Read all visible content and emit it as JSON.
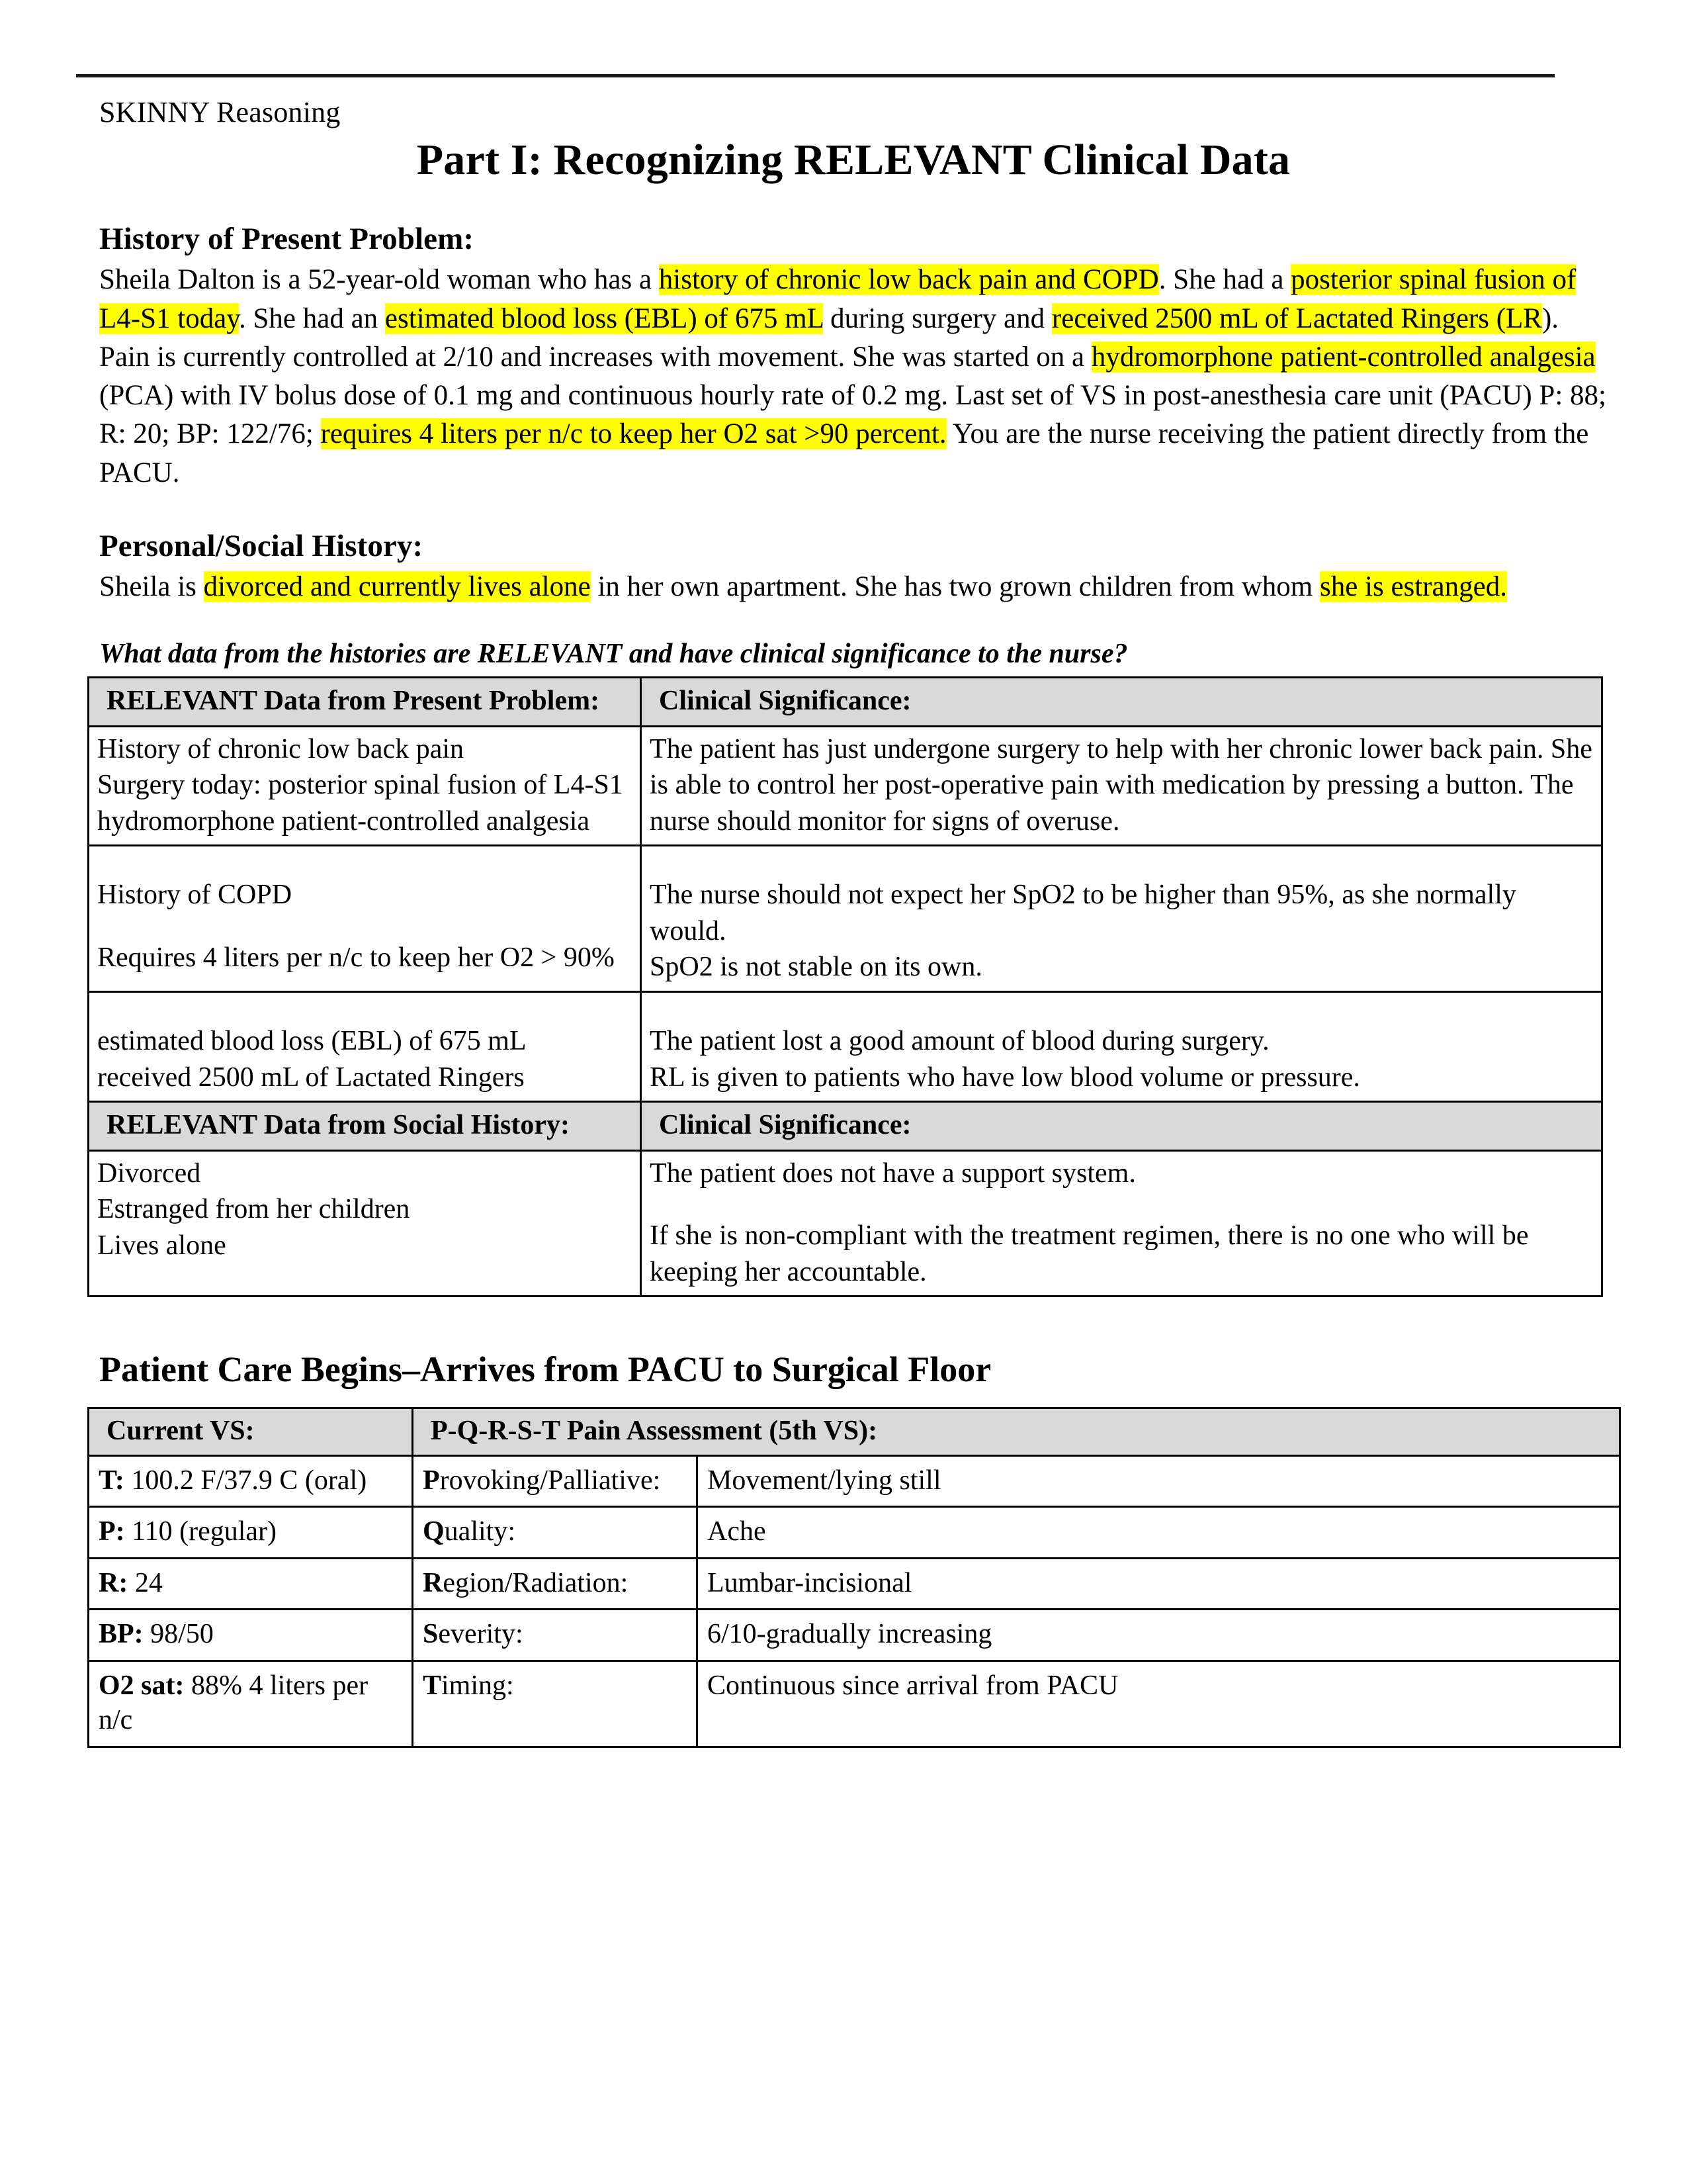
{
  "header": {
    "doc_label": "SKINNY Reasoning",
    "title": "Part I: Recognizing RELEVANT Clinical Data"
  },
  "present_problem": {
    "heading": "History of Present Problem:",
    "segments": [
      {
        "text": "Sheila Dalton is a 52-year-old woman who has a ",
        "highlight": false
      },
      {
        "text": "history of chronic low back pain and COPD",
        "highlight": true
      },
      {
        "text": ". She had a ",
        "highlight": false
      },
      {
        "text": "posterior spinal fusion of L4-S1 today",
        "highlight": true
      },
      {
        "text": ". She had an ",
        "highlight": false
      },
      {
        "text": "estimated blood loss (EBL) of 675 mL",
        "highlight": true
      },
      {
        "text": " during surgery and ",
        "highlight": false
      },
      {
        "text": "received 2500 mL of Lactated Ringers (LR",
        "highlight": true
      },
      {
        "text": "). Pain is currently controlled at 2/10 and increases with movement. She was started on a ",
        "highlight": false
      },
      {
        "text": "hydromorphone patient-controlled analgesia",
        "highlight": true
      },
      {
        "text": " (PCA) with IV bolus dose of 0.1 mg and continuous hourly rate of 0.2 mg. Last set of VS in post-anesthesia care unit (PACU) P: 88; R: 20; BP: 122/76; ",
        "highlight": false
      },
      {
        "text": "requires 4 liters per n/c to keep her O2 sat >90 percent.",
        "highlight": true
      },
      {
        "text": " You are the nurse receiving the patient directly from the PACU.",
        "highlight": false
      }
    ]
  },
  "social_history": {
    "heading": "Personal/Social History:",
    "segments": [
      {
        "text": "Sheila is ",
        "highlight": false
      },
      {
        "text": "divorced and currently lives alone",
        "highlight": true
      },
      {
        "text": " in her own apartment. She has two grown children from whom ",
        "highlight": false
      },
      {
        "text": "she is estranged.",
        "highlight": true
      }
    ]
  },
  "question": "What data from the histories are RELEVANT and have clinical significance to the nurse?",
  "relevant_table": {
    "header_present": {
      "col1": "RELEVANT Data from Present Problem:",
      "col2": "Clinical Significance:"
    },
    "present_rows": {
      "data": [
        "History of chronic low back pain",
        "Surgery today: posterior spinal fusion of L4-S1",
        "hydromorphone patient-controlled analgesia"
      ],
      "significance": "The patient has just undergone surgery to help with her chronic lower back pain. She is able to control her post-operative pain with medication by pressing a button. The nurse should monitor for signs of overuse."
    },
    "copd_row": {
      "data": "History of COPD",
      "significance_1": "The nurse should not expect her SpO2 to be higher than 95%, as she normally would.",
      "data_2": "Requires 4 liters per n/c to keep her O2 > 90%",
      "significance_2": "SpO2 is not stable on its own."
    },
    "blood_row": {
      "data_1": "estimated blood loss (EBL) of 675 mL",
      "significance_1": "The patient lost a good amount of blood during surgery.",
      "data_2": "received 2500 mL of Lactated Ringers",
      "significance_2": "RL is given to patients who have low blood volume or pressure."
    },
    "header_social": {
      "col1": "RELEVANT Data from Social History:",
      "col2": "Clinical Significance:"
    },
    "social_rows": {
      "data": [
        "Divorced",
        "Estranged from her children",
        "Lives alone"
      ],
      "significance_1": "The patient does not have a support system.",
      "significance_2": "If she is non-compliant with the treatment regimen, there is no one who will be keeping her accountable."
    }
  },
  "care_section": {
    "heading": "Patient Care Begins–Arrives from PACU to Surgical Floor",
    "vitals_header": {
      "col1": "Current VS:",
      "col2": "P-Q-R-S-T Pain Assessment (5th VS):"
    },
    "rows": [
      {
        "vs_label": "T:",
        "vs_value": " 100.2 F/37.9 C (oral)",
        "pqrst_cap": "P",
        "pqrst_rest": "rovoking/Palliative:",
        "pqrst_value": "Movement/lying still"
      },
      {
        "vs_label": "P:",
        "vs_value": " 110 (regular)",
        "pqrst_cap": "Q",
        "pqrst_rest": "uality:",
        "pqrst_value": "Ache"
      },
      {
        "vs_label": "R:",
        "vs_value": " 24",
        "pqrst_cap": "R",
        "pqrst_rest": "egion/Radiation:",
        "pqrst_value": "Lumbar-incisional"
      },
      {
        "vs_label": "BP:",
        "vs_value": " 98/50",
        "pqrst_cap": "S",
        "pqrst_rest": "everity:",
        "pqrst_value": "6/10-gradually increasing"
      },
      {
        "vs_label": "O2 sat:",
        "vs_value": " 88% 4 liters per n/c",
        "pqrst_cap": "T",
        "pqrst_rest": "iming:",
        "pqrst_value": "Continuous since arrival from PACU"
      }
    ]
  },
  "colors": {
    "highlight": "#ffff00",
    "table_header_bg": "#d9d9d9",
    "rule": "#1a1a1a"
  }
}
